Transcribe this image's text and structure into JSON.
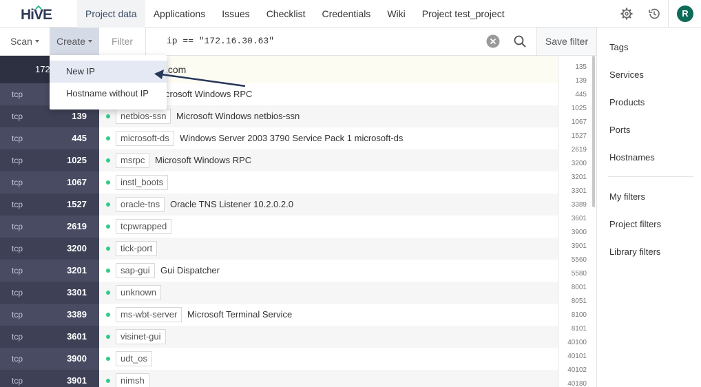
{
  "nav": {
    "logo_text": "HiVE",
    "links": [
      "Project data",
      "Applications",
      "Issues",
      "Checklist",
      "Credentials",
      "Wiki",
      "Project test_project"
    ],
    "avatar_initial": "R"
  },
  "toolbar": {
    "scan_label": "Scan",
    "create_label": "Create",
    "filter_label": "Filter",
    "filter_value": "ip == \"172.16.30.63\"",
    "save_filter_label": "Save filter"
  },
  "dropdown": {
    "items": [
      "New IP",
      "Hostname without IP"
    ],
    "highlighted": "New IP"
  },
  "host": {
    "ip_fragment": "172",
    "hostname_fragment": ".com"
  },
  "rows": [
    {
      "proto": "tcp",
      "port": "",
      "service": "",
      "product": "crosoft Windows RPC"
    },
    {
      "proto": "tcp",
      "port": "139",
      "service": "netbios-ssn",
      "product": "Microsoft Windows netbios-ssn"
    },
    {
      "proto": "tcp",
      "port": "445",
      "service": "microsoft-ds",
      "product": "Windows Server 2003 3790 Service Pack 1 microsoft-ds"
    },
    {
      "proto": "tcp",
      "port": "1025",
      "service": "msrpc",
      "product": "Microsoft Windows RPC"
    },
    {
      "proto": "tcp",
      "port": "1067",
      "service": "instl_boots",
      "product": ""
    },
    {
      "proto": "tcp",
      "port": "1527",
      "service": "oracle-tns",
      "product": "Oracle TNS Listener 10.2.0.2.0"
    },
    {
      "proto": "tcp",
      "port": "2619",
      "service": "tcpwrapped",
      "product": ""
    },
    {
      "proto": "tcp",
      "port": "3200",
      "service": "tick-port",
      "product": ""
    },
    {
      "proto": "tcp",
      "port": "3201",
      "service": "sap-gui",
      "product": "Gui Dispatcher"
    },
    {
      "proto": "tcp",
      "port": "3301",
      "service": "unknown",
      "product": ""
    },
    {
      "proto": "tcp",
      "port": "3389",
      "service": "ms-wbt-server",
      "product": "Microsoft Terminal Service"
    },
    {
      "proto": "tcp",
      "port": "3601",
      "service": "visinet-gui",
      "product": ""
    },
    {
      "proto": "tcp",
      "port": "3900",
      "service": "udt_os",
      "product": ""
    },
    {
      "proto": "tcp",
      "port": "3901",
      "service": "nimsh",
      "product": ""
    }
  ],
  "minimap_ports": [
    "135",
    "139",
    "445",
    "1025",
    "1067",
    "1527",
    "2619",
    "3200",
    "3201",
    "3301",
    "3389",
    "3601",
    "3900",
    "3901",
    "5560",
    "5580",
    "8001",
    "8051",
    "8100",
    "8101",
    "40100",
    "40101",
    "40102",
    "40180"
  ],
  "sidebar": {
    "groups": [
      [
        "Tags",
        "Services",
        "Products",
        "Ports",
        "Hostnames"
      ],
      [
        "My filters",
        "Project filters",
        "Library filters"
      ]
    ]
  },
  "colors": {
    "host_dark": "#2c3040",
    "port_col": "#484b62",
    "status_dot": "#2fcb88",
    "avatar": "#0d6b57",
    "arrow": "#27375a"
  },
  "icons": [
    "hive-logo-icon",
    "gear-icon",
    "history-icon",
    "clear-icon",
    "search-icon",
    "caret-down-icon",
    "arrow-icon"
  ]
}
